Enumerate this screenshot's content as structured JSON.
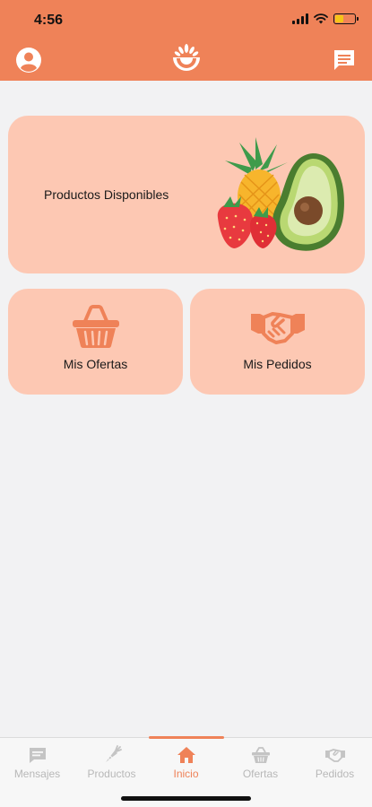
{
  "status_bar": {
    "time": "4:56",
    "icons": [
      "signal-icon",
      "wifi-icon",
      "battery-icon"
    ]
  },
  "header": {
    "left_icon": "profile-icon",
    "logo": "app-logo",
    "right_icon": "message-icon"
  },
  "cards": {
    "products": {
      "label": "Productos Disponibles",
      "icon": "fruits-illustration"
    },
    "offers": {
      "label": "Mis Ofertas",
      "icon": "basket-icon"
    },
    "orders": {
      "label": "Mis Pedidos",
      "icon": "handshake-icon"
    }
  },
  "tabbar": {
    "items": [
      {
        "label": "Mensajes",
        "icon": "chat-icon"
      },
      {
        "label": "Productos",
        "icon": "carrot-icon"
      },
      {
        "label": "Inicio",
        "icon": "home-icon"
      },
      {
        "label": "Ofertas",
        "icon": "basket-icon"
      },
      {
        "label": "Pedidos",
        "icon": "handshake-icon"
      }
    ],
    "active": "Inicio"
  },
  "colors": {
    "brand": "#ef8258",
    "card": "#fdc8b3",
    "background": "#f2f2f3",
    "inactive_tab": "#b8b8b8"
  }
}
